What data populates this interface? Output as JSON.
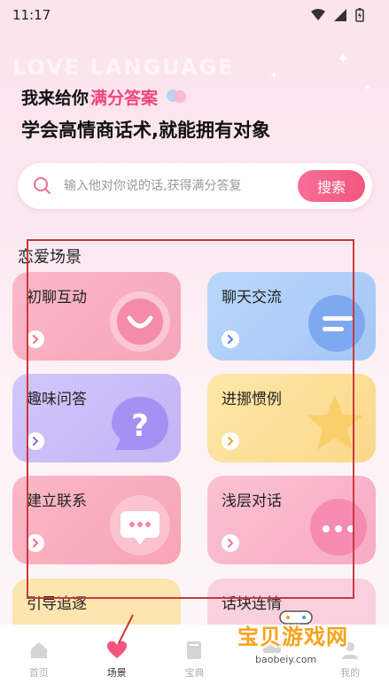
{
  "status_bar": {
    "time": "11:17"
  },
  "header": {
    "bg_wordmark": "LOVE LANGUAGE",
    "headline_prefix": "我来给你",
    "headline_accent": "满分答案",
    "headline_line2": "学会高情商话术,就能拥有对象"
  },
  "search": {
    "placeholder": "输入他对你说的话,获得满分答复",
    "button_label": "搜索"
  },
  "section": {
    "title": "恋爱场景"
  },
  "cards": [
    {
      "label": "初聊互动",
      "icon": "smile-bubble-icon",
      "bg_from": "#fbb8c8",
      "bg_to": "#f6a5b9",
      "arrow_color": "#f07090"
    },
    {
      "label": "聊天交流",
      "icon": "chat-lines-icon",
      "bg_from": "#b9d7fb",
      "bg_to": "#a6c7f6",
      "arrow_color": "#4a86e8"
    },
    {
      "label": "趣味问答",
      "icon": "question-bubble-icon",
      "bg_from": "#d3c6fb",
      "bg_to": "#c2b4f6",
      "arrow_color": "#8a6de0"
    },
    {
      "label": "进挪惯例",
      "icon": "star-icon",
      "bg_from": "#fde7a8",
      "bg_to": "#fbd88a",
      "arrow_color": "#e3a93a"
    },
    {
      "label": "建立联系",
      "icon": "message-dots-icon",
      "bg_from": "#fbb8c6",
      "bg_to": "#f7a3b6",
      "arrow_color": "#ef6d8d"
    },
    {
      "label": "浅层对话",
      "icon": "ellipsis-bubble-icon",
      "bg_from": "#fbc1d3",
      "bg_to": "#f8abc4",
      "arrow_color": "#ee6f9b"
    },
    {
      "label": "引导追逐",
      "icon": "",
      "bg_from": "#fde5b0",
      "bg_to": "#fde5b0",
      "arrow_color": "#e3a93a"
    },
    {
      "label": "话块连情",
      "icon": "",
      "bg_from": "#fbd0de",
      "bg_to": "#fbd0de",
      "arrow_color": "#ee6f9b"
    }
  ],
  "bottom_nav": [
    {
      "label": "首页",
      "icon": "home-icon",
      "active": false
    },
    {
      "label": "场景",
      "icon": "heart-icon",
      "active": true
    },
    {
      "label": "宝典",
      "icon": "book-icon",
      "active": false
    },
    {
      "label": "",
      "icon": "chat-icon",
      "active": false
    },
    {
      "label": "我的",
      "icon": "user-icon",
      "active": false
    }
  ],
  "watermark": {
    "title": "宝贝游戏网",
    "domain": "baobeiy.com"
  },
  "colors": {
    "accent": "#f0467a",
    "button": "#f2567f",
    "annotation": "#c83a3a"
  }
}
